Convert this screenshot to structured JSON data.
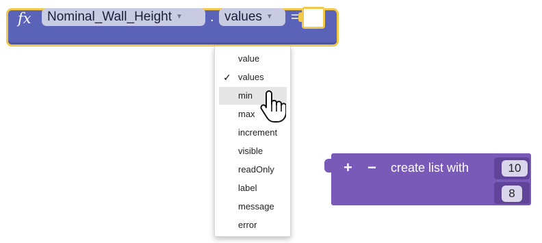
{
  "fx_block": {
    "icon_label": "fx",
    "variable_dropdown": "Nominal_Wall_Height",
    "dot_label": ".",
    "property_dropdown": "values",
    "equals_label": "="
  },
  "menu": {
    "items": [
      {
        "label": "value",
        "checked": false,
        "highlighted": false
      },
      {
        "label": "values",
        "checked": true,
        "highlighted": false
      },
      {
        "label": "min",
        "checked": false,
        "highlighted": true
      },
      {
        "label": "max",
        "checked": false,
        "highlighted": false
      },
      {
        "label": "increment",
        "checked": false,
        "highlighted": false
      },
      {
        "label": "visible",
        "checked": false,
        "highlighted": false
      },
      {
        "label": "readOnly",
        "checked": false,
        "highlighted": false
      },
      {
        "label": "label",
        "checked": false,
        "highlighted": false
      },
      {
        "label": "message",
        "checked": false,
        "highlighted": false
      },
      {
        "label": "error",
        "checked": false,
        "highlighted": false
      }
    ],
    "check_mark": "✓"
  },
  "list_block": {
    "plus_label": "+",
    "minus_label": "−",
    "label": "create list with",
    "items": [
      "10",
      "8"
    ]
  },
  "colors": {
    "fx_block": "#5b63b8",
    "fx_outline": "#f2c84b",
    "list_block": "#7a5ab8",
    "menu_highlight": "#e6e6e6"
  },
  "icons": {
    "cursor": "hand-pointer-icon",
    "dropdown_arrow": "caret-down-icon"
  }
}
